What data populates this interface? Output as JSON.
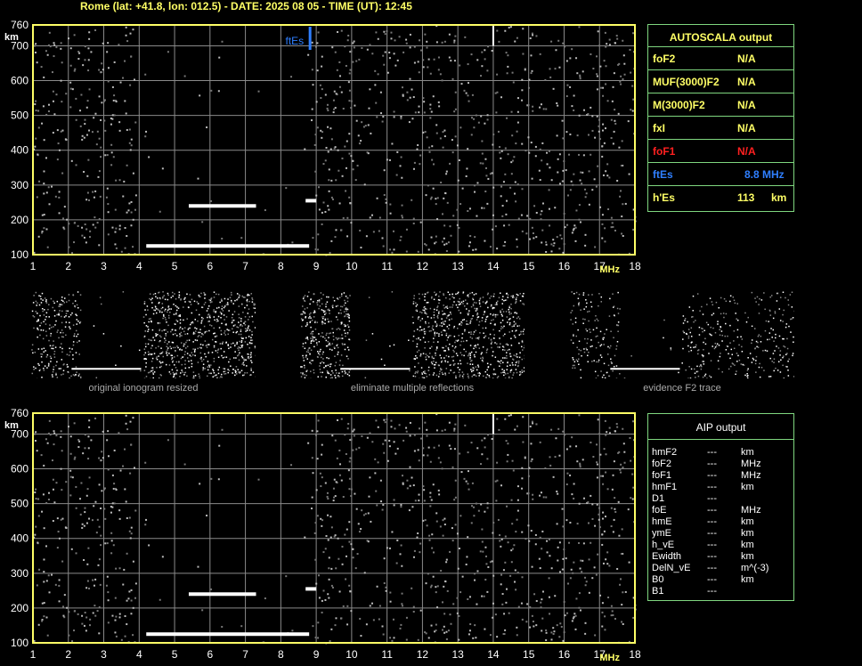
{
  "header": "Rome (lat: +41.8, lon: 012.5) - DATE: 2025 08 05 - TIME (UT): 12:45",
  "colors": {
    "grid": "#8a8a8a",
    "axis": "#ffff66",
    "frame": "#7fd67f",
    "foes": "#2f7fff",
    "fof1": "#ff2020"
  },
  "chart_data": [
    {
      "type": "scatter",
      "id": "top-ionogram",
      "xlabel": "MHz",
      "ylabel": "km",
      "xlim": [
        1,
        18
      ],
      "ylim": [
        100,
        760
      ],
      "xticks": [
        "1",
        "2",
        "3",
        "4",
        "5",
        "6",
        "7",
        "8",
        "9",
        "10",
        "11",
        "12",
        "13",
        "14",
        "15",
        "16",
        "17",
        "18"
      ],
      "yticks": [
        "100",
        "200",
        "300",
        "400",
        "500",
        "600",
        "700",
        "760"
      ],
      "annotation": {
        "label": "ftEs",
        "x": 8.8
      },
      "traces": [
        {
          "name": "Es",
          "x_start": 4.2,
          "x_end": 8.8,
          "y": 125
        },
        {
          "name": "Es2",
          "x_start": 5.4,
          "x_end": 7.3,
          "y": 240
        },
        {
          "name": "Es3",
          "x_start": 8.7,
          "x_end": 9.0,
          "y": 255
        }
      ]
    },
    {
      "type": "scatter",
      "id": "bottom-ionogram",
      "xlabel": "MHz",
      "ylabel": "km",
      "xlim": [
        1,
        18
      ],
      "ylim": [
        100,
        760
      ],
      "xticks": [
        "1",
        "2",
        "3",
        "4",
        "5",
        "6",
        "7",
        "8",
        "9",
        "10",
        "11",
        "12",
        "13",
        "14",
        "15",
        "16",
        "17",
        "18"
      ],
      "yticks": [
        "100",
        "200",
        "300",
        "400",
        "500",
        "600",
        "700",
        "760"
      ],
      "traces": [
        {
          "name": "Es",
          "x_start": 4.2,
          "x_end": 8.8,
          "y": 125
        },
        {
          "name": "Es2",
          "x_start": 5.4,
          "x_end": 7.3,
          "y": 240
        },
        {
          "name": "Es3",
          "x_start": 8.7,
          "x_end": 9.0,
          "y": 255
        }
      ]
    }
  ],
  "autoscala": {
    "title": "AUTOSCALA output",
    "rows": [
      {
        "label": "foF2",
        "value": "N/A",
        "unit": ""
      },
      {
        "label": "MUF(3000)F2",
        "value": "N/A",
        "unit": ""
      },
      {
        "label": "M(3000)F2",
        "value": "N/A",
        "unit": ""
      },
      {
        "label": "fxI",
        "value": "N/A",
        "unit": ""
      },
      {
        "label": "foF1",
        "value": "N/A",
        "unit": ""
      },
      {
        "label": "ftEs",
        "value": "8.8 MHz",
        "unit": ""
      },
      {
        "label": "h'Es",
        "value": "113",
        "unit": "km"
      }
    ]
  },
  "thumbnails": [
    {
      "caption": "original ionogram resized"
    },
    {
      "caption": "eliminate multiple reflections"
    },
    {
      "caption": "evidence F2 trace"
    }
  ],
  "aip": {
    "title": "AIP output",
    "rows": [
      {
        "label": "hmF2",
        "value": "---",
        "unit": "km"
      },
      {
        "label": "foF2",
        "value": "---",
        "unit": "MHz"
      },
      {
        "label": "foF1",
        "value": "---",
        "unit": "MHz"
      },
      {
        "label": "hmF1",
        "value": "---",
        "unit": "km"
      },
      {
        "label": "D1",
        "value": "---",
        "unit": ""
      },
      {
        "label": "foE",
        "value": "---",
        "unit": "MHz"
      },
      {
        "label": "hmE",
        "value": "---",
        "unit": "km"
      },
      {
        "label": "ymE",
        "value": "---",
        "unit": "km"
      },
      {
        "label": "h_vE",
        "value": "---",
        "unit": "km"
      },
      {
        "label": "Ewidth",
        "value": "---",
        "unit": "km"
      },
      {
        "label": "DelN_vE",
        "value": "---",
        "unit": "m^(-3)"
      },
      {
        "label": "B0",
        "value": "---",
        "unit": "km"
      },
      {
        "label": "B1",
        "value": "---",
        "unit": ""
      }
    ]
  }
}
